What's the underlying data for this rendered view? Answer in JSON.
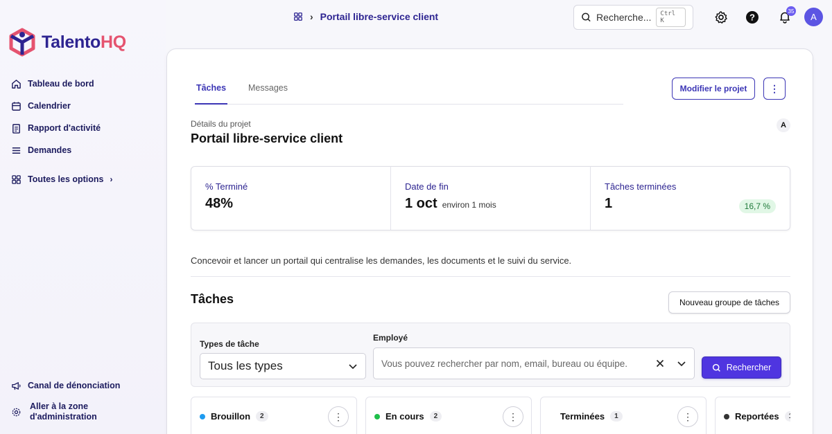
{
  "brand": {
    "name_part1": "Talento",
    "name_part2": "HQ"
  },
  "sidebar": {
    "items": [
      {
        "label": "Tableau de bord",
        "icon": "home-icon"
      },
      {
        "label": "Calendrier",
        "icon": "calendar-icon"
      },
      {
        "label": "Rapport d'activité",
        "icon": "report-icon"
      },
      {
        "label": "Demandes",
        "icon": "list-icon"
      }
    ],
    "all_options": "Toutes les options",
    "bottom": [
      {
        "label": "Canal de dénonciation",
        "icon": "megaphone-icon"
      },
      {
        "label": "Aller à la zone d'administration",
        "icon": "gear-icon"
      }
    ]
  },
  "topbar": {
    "breadcrumb": "Portail libre-service client",
    "search_placeholder": "Recherche...",
    "search_shortcut": "Ctrl K",
    "notification_count": "35",
    "avatar_initial": "A"
  },
  "project": {
    "tabs": [
      "Tâches",
      "Messages"
    ],
    "edit_button": "Modifier le projet",
    "details_label": "Détails du projet",
    "title": "Portail libre-service client",
    "owner_initial": "A",
    "stats": {
      "percent_label": "% Terminé",
      "percent_value": "48%",
      "end_label": "Date de fin",
      "end_value": "1 oct",
      "end_sub": "environ 1 mois",
      "done_label": "Tâches terminées",
      "done_value": "1",
      "done_pct": "16,7 %"
    },
    "description": "Concevoir et lancer un portail qui centralise les demandes, les documents et le suivi du service."
  },
  "tasks": {
    "title": "Tâches",
    "new_group_button": "Nouveau groupe de tâches",
    "filters": {
      "type_label": "Types de tâche",
      "type_value": "Tous les types",
      "employee_label": "Employé",
      "employee_placeholder": "Vous pouvez rechercher par nom, email, bureau ou équipe.",
      "search_button": "Rechercher"
    },
    "columns": [
      {
        "label": "Brouillon",
        "count": "2",
        "color": "#1e9bf0"
      },
      {
        "label": "En cours",
        "count": "2",
        "color": "#1fbf4a"
      },
      {
        "label": "Terminées",
        "count": "1",
        "color": "#ffffff"
      },
      {
        "label": "Reportées",
        "count": "1",
        "color": "#333333"
      }
    ]
  }
}
